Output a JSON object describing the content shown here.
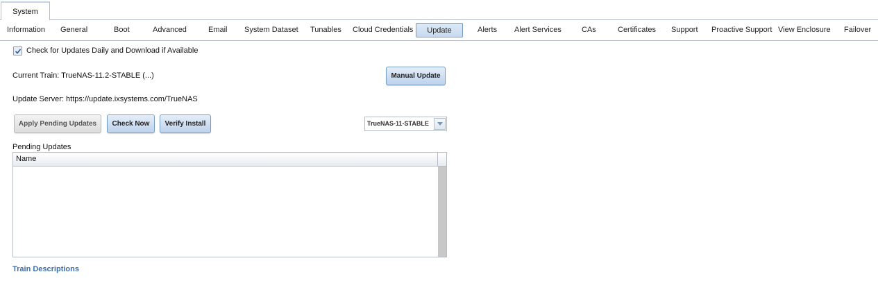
{
  "top_tabs": [
    {
      "label": "System"
    }
  ],
  "subtabs": [
    {
      "label": "Information"
    },
    {
      "label": "General"
    },
    {
      "label": "Boot"
    },
    {
      "label": "Advanced"
    },
    {
      "label": "Email"
    },
    {
      "label": "System Dataset"
    },
    {
      "label": "Tunables"
    },
    {
      "label": "Cloud Credentials"
    },
    {
      "label": "Update"
    },
    {
      "label": "Alerts"
    },
    {
      "label": "Alert Services"
    },
    {
      "label": "CAs"
    },
    {
      "label": "Certificates"
    },
    {
      "label": "Support"
    },
    {
      "label": "Proactive Support"
    },
    {
      "label": "View Enclosure"
    },
    {
      "label": "Failover"
    }
  ],
  "active_subtab": "Update",
  "update": {
    "auto_check_label": "Check for Updates Daily and Download if Available",
    "auto_check_checked": true,
    "current_train": "Current Train: TrueNAS-11.2-STABLE (...)",
    "update_server": "Update Server: https://update.ixsystems.com/TrueNAS",
    "manual_update_label": "Manual Update",
    "apply_pending_label": "Apply Pending Updates",
    "check_now_label": "Check Now",
    "verify_install_label": "Verify Install",
    "train_select_value": "TrueNAS-11-STABLE",
    "pending_updates_label": "Pending Updates",
    "pending_columns": [
      {
        "label": "Name"
      }
    ],
    "pending_rows": [],
    "train_descriptions_label": "Train Descriptions"
  },
  "colors": {
    "accent_border": "#759dc0",
    "link": "#3f6ea8"
  }
}
